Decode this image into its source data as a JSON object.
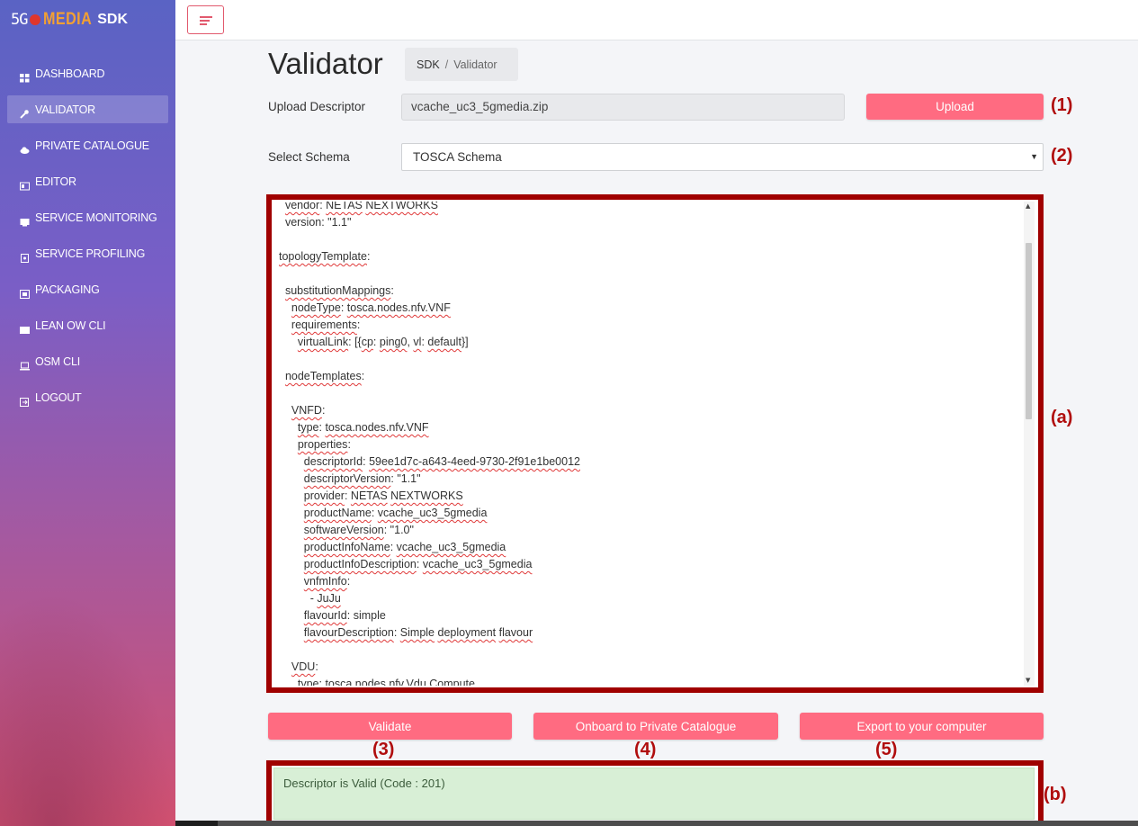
{
  "brand": {
    "logo_5g": "5G",
    "logo_media": "MEDIA",
    "logo_sdk": "SDK",
    "colors": {
      "accent": "#ff6b81",
      "annotation": "#b00d0d",
      "success_bg": "#d8efd6"
    }
  },
  "sidebar": {
    "items": [
      {
        "label": "DASHBOARD",
        "icon": "grid-icon",
        "active": false
      },
      {
        "label": "VALIDATOR",
        "icon": "wrench-icon",
        "active": true
      },
      {
        "label": "PRIVATE CATALOGUE",
        "icon": "cloud-icon",
        "active": false
      },
      {
        "label": "EDITOR",
        "icon": "editor-icon",
        "active": false
      },
      {
        "label": "SERVICE MONITORING",
        "icon": "monitor-icon",
        "active": false
      },
      {
        "label": "SERVICE PROFILING",
        "icon": "file-icon",
        "active": false
      },
      {
        "label": "PACKAGING",
        "icon": "package-icon",
        "active": false
      },
      {
        "label": "LEAN OW CLI",
        "icon": "terminal-icon",
        "active": false
      },
      {
        "label": "OSM CLI",
        "icon": "laptop-icon",
        "active": false
      },
      {
        "label": "LOGOUT",
        "icon": "logout-icon",
        "active": false
      }
    ]
  },
  "header": {
    "title": "Validator",
    "breadcrumb": {
      "root": "SDK",
      "separator": "/",
      "current": "Validator"
    }
  },
  "form": {
    "upload_label": "Upload Descriptor",
    "upload_value": "vcache_uc3_5gmedia.zip",
    "upload_button": "Upload",
    "schema_label": "Select Schema",
    "schema_selected": "TOSCA Schema"
  },
  "annotations": {
    "a1": "(1)",
    "a2": "(2)",
    "aa": "(a)",
    "a3": "(3)",
    "a4": "(4)",
    "a5": "(5)",
    "ab": "(b)"
  },
  "editor": {
    "lines": [
      [
        {
          "t": "  "
        },
        {
          "t": "vendor",
          "sq": true
        },
        {
          "t": ": "
        },
        {
          "t": "NETAS",
          "sq": true
        },
        {
          "t": " "
        },
        {
          "t": "NEXTWORKS",
          "sq": true
        }
      ],
      [
        {
          "t": "  version: \"1.1\""
        }
      ],
      [
        {
          "t": ""
        }
      ],
      [
        {
          "t": "topologyTemplate",
          "sq": true
        },
        {
          "t": ":"
        }
      ],
      [
        {
          "t": ""
        }
      ],
      [
        {
          "t": "  "
        },
        {
          "t": "substitutionMappings",
          "sq": true
        },
        {
          "t": ":"
        }
      ],
      [
        {
          "t": "    "
        },
        {
          "t": "nodeType",
          "sq": true
        },
        {
          "t": ": "
        },
        {
          "t": "tosca.nodes.nfv.VNF",
          "sq": true
        }
      ],
      [
        {
          "t": "    "
        },
        {
          "t": "requirements",
          "sq": true
        },
        {
          "t": ":"
        }
      ],
      [
        {
          "t": "      "
        },
        {
          "t": "virtualLink",
          "sq": true
        },
        {
          "t": ": [{"
        },
        {
          "t": "cp",
          "sq": true
        },
        {
          "t": ": "
        },
        {
          "t": "ping0",
          "sq": true
        },
        {
          "t": ", "
        },
        {
          "t": "vl",
          "sq": true
        },
        {
          "t": ": "
        },
        {
          "t": "default",
          "sq": true
        },
        {
          "t": "}]"
        }
      ],
      [
        {
          "t": ""
        }
      ],
      [
        {
          "t": "  "
        },
        {
          "t": "nodeTemplates",
          "sq": true
        },
        {
          "t": ":"
        }
      ],
      [
        {
          "t": ""
        }
      ],
      [
        {
          "t": "    "
        },
        {
          "t": "VNFD",
          "sq": true
        },
        {
          "t": ":"
        }
      ],
      [
        {
          "t": "      "
        },
        {
          "t": "type",
          "sq": true
        },
        {
          "t": ": "
        },
        {
          "t": "tosca.nodes.nfv.VNF",
          "sq": true
        }
      ],
      [
        {
          "t": "      "
        },
        {
          "t": "properties",
          "sq": true
        },
        {
          "t": ":"
        }
      ],
      [
        {
          "t": "        "
        },
        {
          "t": "descriptorId",
          "sq": true
        },
        {
          "t": ": "
        },
        {
          "t": "59ee1d7c-a643-4eed-9730-2f91e1be0012",
          "sq": true
        }
      ],
      [
        {
          "t": "        "
        },
        {
          "t": "descriptorVersion",
          "sq": true
        },
        {
          "t": ": \"1.1\""
        }
      ],
      [
        {
          "t": "        "
        },
        {
          "t": "provider",
          "sq": true
        },
        {
          "t": ": "
        },
        {
          "t": "NETAS",
          "sq": true
        },
        {
          "t": " "
        },
        {
          "t": "NEXTWORKS",
          "sq": true
        }
      ],
      [
        {
          "t": "        "
        },
        {
          "t": "productName",
          "sq": true
        },
        {
          "t": ": "
        },
        {
          "t": "vcache_uc3_5gmedia",
          "sq": true
        }
      ],
      [
        {
          "t": "        "
        },
        {
          "t": "softwareVersion",
          "sq": true
        },
        {
          "t": ": \"1.0\""
        }
      ],
      [
        {
          "t": "        "
        },
        {
          "t": "productInfoName",
          "sq": true
        },
        {
          "t": ": "
        },
        {
          "t": "vcache_uc3_5gmedia",
          "sq": true
        }
      ],
      [
        {
          "t": "        "
        },
        {
          "t": "productInfoDescription",
          "sq": true
        },
        {
          "t": ": "
        },
        {
          "t": "vcache_uc3_5gmedia",
          "sq": true
        }
      ],
      [
        {
          "t": "        "
        },
        {
          "t": "vnfmInfo",
          "sq": true
        },
        {
          "t": ":"
        }
      ],
      [
        {
          "t": "          - "
        },
        {
          "t": "JuJu",
          "sq": true
        }
      ],
      [
        {
          "t": "        "
        },
        {
          "t": "flavourId",
          "sq": true
        },
        {
          "t": ": simple"
        }
      ],
      [
        {
          "t": "        "
        },
        {
          "t": "flavourDescription",
          "sq": true
        },
        {
          "t": ": "
        },
        {
          "t": "Simple",
          "sq": true
        },
        {
          "t": " "
        },
        {
          "t": "deployment",
          "sq": true
        },
        {
          "t": " "
        },
        {
          "t": "flavour",
          "sq": true
        }
      ],
      [
        {
          "t": ""
        }
      ],
      [
        {
          "t": "    "
        },
        {
          "t": "VDU",
          "sq": true
        },
        {
          "t": ":"
        }
      ],
      [
        {
          "t": "      "
        },
        {
          "t": "type",
          "sq": true
        },
        {
          "t": ": "
        },
        {
          "t": "tosca.nodes.nfv.Vdu.Compute",
          "sq": true
        }
      ]
    ]
  },
  "actions": {
    "validate": "Validate",
    "onboard": "Onboard to Private Catalogue",
    "export": "Export to your computer"
  },
  "result": {
    "message": "Descriptor is Valid (Code : 201)"
  }
}
